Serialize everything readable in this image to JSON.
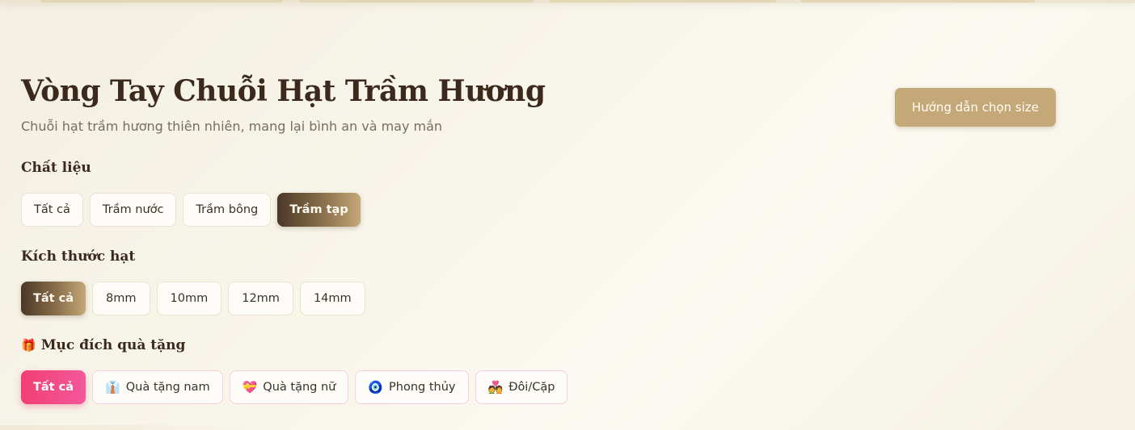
{
  "header": {
    "title": "Vòng Tay Chuỗi Hạt Trầm Hương",
    "subtitle": "Chuỗi hạt trầm hương thiên nhiên, mang lại bình an và may mắn",
    "guide_button": "Hướng dẫn chọn size"
  },
  "filters": {
    "material": {
      "label": "Chất liệu",
      "options": [
        "Tất cả",
        "Trầm nước",
        "Trầm bông",
        "Trầm tạp"
      ],
      "selected": "Trầm tạp"
    },
    "bead_size": {
      "label": "Kích thước hạt",
      "options": [
        "Tất cả",
        "8mm",
        "10mm",
        "12mm",
        "14mm"
      ],
      "selected": "Tất cả"
    },
    "gift": {
      "icon": "🎁",
      "label": "Mục đích quà tặng",
      "options": [
        {
          "label": "Tất cả",
          "icon": ""
        },
        {
          "label": "Quà tặng nam",
          "icon": "👔"
        },
        {
          "label": "Quà tặng nữ",
          "icon": "💝"
        },
        {
          "label": "Phong thủy",
          "icon": "🧿"
        },
        {
          "label": "Đôi/Cặp",
          "icon": "💑"
        }
      ],
      "selected": "Tất cả"
    }
  },
  "colors": {
    "accent_brown": "#c5a877",
    "active_brown_dark": "#4a3826",
    "active_pink": "#f23f73",
    "background": "#f8f5ea"
  }
}
